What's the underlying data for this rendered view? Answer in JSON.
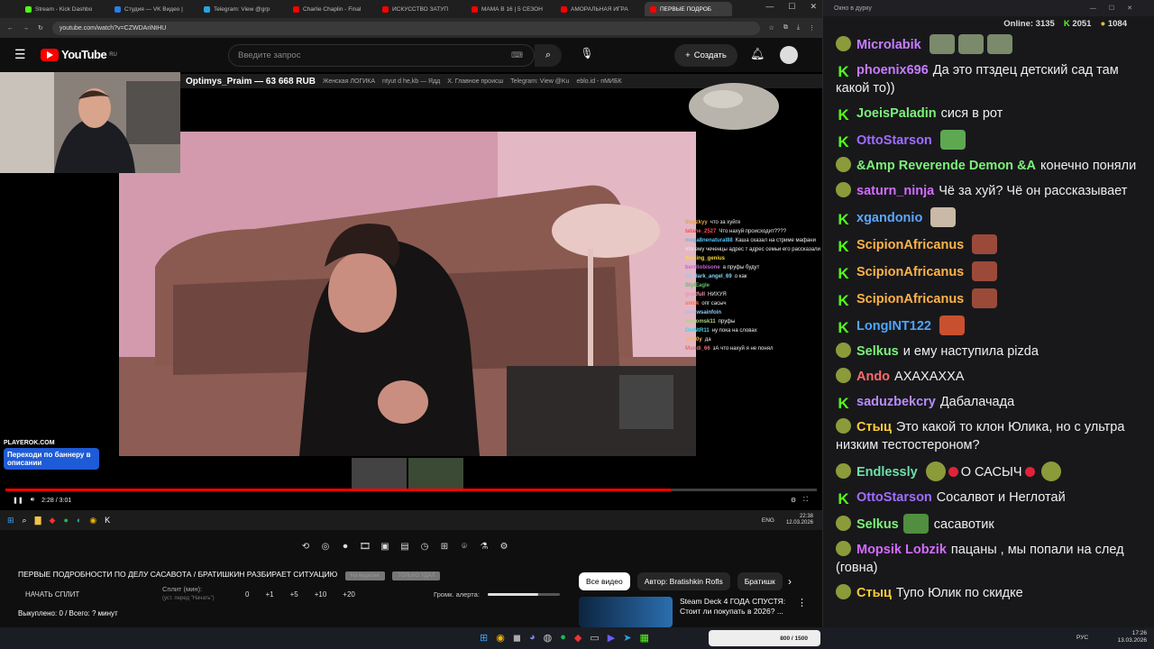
{
  "browser": {
    "tabs": [
      {
        "label": "Stream - Kick Dashbo",
        "color": "#53fc18"
      },
      {
        "label": "Студия — VK Видео |",
        "color": "#2c7be5"
      },
      {
        "label": "Telegram: View @grp",
        "color": "#2aa3e0"
      },
      {
        "label": "Charlie Chaplin - Final",
        "color": "#ff0000"
      },
      {
        "label": "ИСКУССТВО ЗАТУП",
        "color": "#ff0000"
      },
      {
        "label": "МАМА В 16 | 5 СЕЗОН",
        "color": "#ff0000"
      },
      {
        "label": "АМОРАЛЬНАЯ ИГРА",
        "color": "#ff0000"
      },
      {
        "label": "ПЕРВЫЕ ПОДРОБ",
        "color": "#ff0000"
      }
    ],
    "url": "youtube.com/watch?v=CZWDAriNtHU"
  },
  "youtube": {
    "logo": "YouTube",
    "region": "RU",
    "search_placeholder": "Введите запрос",
    "create_label": "Создать"
  },
  "player": {
    "inner_tabs": [
      "Optimys_Praim — 63 668 RUB",
      "Женская ЛОГИКА",
      "ntyut d he,kb — Ядд",
      "Х. Главное происш",
      "Telegram: View @Ku",
      "eblo.id - пМИБК"
    ],
    "overlay_chat": [
      {
        "user": "lilayzkyy",
        "text": "что за хуйгя",
        "color": "#e9a33a"
      },
      {
        "user": "tatane_2527",
        "text": "Что нахуй происходит????",
        "color": "#ff4a4a"
      },
      {
        "user": "mega8nenatural88",
        "text": "Каша сказал на стриме мафани что ему чеченцы адрес т адрес семьи его рассказали",
        "color": "#4fc3f7"
      },
      {
        "user": "fucking_genius",
        "text": "",
        "color": "#fdd835"
      },
      {
        "user": "burritobisone",
        "text": "а пруфы будут",
        "color": "#ba68c8"
      },
      {
        "user": "69_dark_angel_69",
        "text": "о как",
        "color": "#81d4fa"
      },
      {
        "user": "StylEagle",
        "text": "",
        "color": "#66bb6a"
      },
      {
        "user": "graitfull",
        "text": "НИХУЯ",
        "color": "#f48fb1"
      },
      {
        "user": "snick",
        "text": "опг сасыч",
        "color": "#ff7043"
      },
      {
        "user": "meowsainfoin",
        "text": "",
        "color": "#90caf9"
      },
      {
        "user": "wenomsk11",
        "text": "пруфы",
        "color": "#aed581"
      },
      {
        "user": "DmNtR11",
        "text": "ну пока на словах",
        "color": "#4dd0e1"
      },
      {
        "user": "lesh0y",
        "text": "да",
        "color": "#ffb74d"
      },
      {
        "user": "Mundi_66",
        "text": "зА что нахуй я не понял",
        "color": "#e57373"
      }
    ],
    "promo_brand": "PLAYEROK.COM",
    "promo_text": "Переходи по баннеру в описании",
    "time": "2:28 / 3:01",
    "progress": 0.82
  },
  "inner_taskbar": {
    "lang": "ENG",
    "time": "22:38",
    "date": "12.03.2026"
  },
  "extension": {
    "video_title": "ПЕРВЫЕ ПОДРОБНОСТИ ПО ДЕЛУ САСАВОТА / БРАТИШКИН РАЗБИРАЕТ СИТУАЦИЮ",
    "chip1": "На видеоке",
    "chip2": "ТОЛЬКО УДАЛ",
    "split_button": "НАЧАТЬ СПЛИТ",
    "split_label": "Сплит (мин):",
    "split_hint": "(уст. перед \"Начать\")",
    "split_options": [
      "0",
      "+1",
      "+5",
      "+10",
      "+20"
    ],
    "volume_label": "Громк. алерта:",
    "volume_level": 0.7,
    "stats": "Выкуплено: 0 / Всего: ? минут"
  },
  "video_tabs": [
    "Все видео",
    "Автор: Bratishkin Rofls",
    "Братишк"
  ],
  "recommendation": {
    "title": "Steam Deck 4 ГОДА СПУСТЯ: Стоит ли покупать в 2026? ..."
  },
  "os": {
    "lang": "РУС",
    "time": "17:26",
    "date": "13.03.2026",
    "widget": "800 / 1500"
  },
  "chat": {
    "window_title": "Окно в дурку",
    "online_label": "Online:",
    "online_count": "3135",
    "stat1": "2051",
    "stat2": "1084",
    "messages": [
      {
        "badge": "pepe",
        "user": "Microlabik",
        "color": "#c77dff",
        "text": "",
        "emotes": [
          "#7a8a6a",
          "#7a8a6a",
          "#7a8a6a"
        ]
      },
      {
        "badge": "k",
        "user": "phoenix696",
        "color": "#c77dff",
        "text": "Да это птздец детский сад там какой то))"
      },
      {
        "badge": "k",
        "user": "JoeisPaladin",
        "color": "#7cf178",
        "text": "сися в рот"
      },
      {
        "badge": "k",
        "user": "OttoStarson",
        "color": "#a06dff",
        "text": "",
        "emotes": [
          "#5fa852"
        ]
      },
      {
        "badge": "pepe",
        "user": "&Amp Reverende Demon &A",
        "color": "#7cf178",
        "text": "конечно поняли"
      },
      {
        "badge": "pepe",
        "user": "saturn_ninja",
        "color": "#d36bff",
        "text": "Чё за хуй? Чё он рассказывает"
      },
      {
        "badge": "k",
        "user": "xgandonio",
        "color": "#5aa8ff",
        "text": "",
        "emotes": [
          "#c9b9a6"
        ]
      },
      {
        "badge": "k",
        "user": "ScipionAfricanus",
        "color": "#ffb347",
        "text": "",
        "emotes": [
          "#9b4a3a"
        ]
      },
      {
        "badge": "k",
        "user": "ScipionAfricanus",
        "color": "#ffb347",
        "text": "",
        "emotes": [
          "#9b4a3a"
        ]
      },
      {
        "badge": "k",
        "user": "ScipionAfricanus",
        "color": "#ffb347",
        "text": "",
        "emotes": [
          "#9b4a3a"
        ]
      },
      {
        "badge": "k",
        "user": "LongINT122",
        "color": "#4da6ff",
        "text": "",
        "emotes": [
          "#c8502e"
        ]
      },
      {
        "badge": "pepe",
        "user": "Selkus",
        "color": "#7cf178",
        "text": "и ему наступила pizda"
      },
      {
        "badge": "pepe",
        "user": "Ando",
        "color": "#ff6b6b",
        "text": "АХАХАХХА"
      },
      {
        "badge": "k",
        "user": "saduzbekcry",
        "color": "#b98cff",
        "text": "Дабалачада"
      },
      {
        "badge": "pepe",
        "user": "Стыц",
        "color": "#ffcc33",
        "text": "Это какой то клон Юлика, но с ультра низким тестостероном?"
      },
      {
        "badge": "pepe",
        "user": "Endlessly",
        "color": "#6ee0a8",
        "text": "О САСЫЧ",
        "special": true
      },
      {
        "badge": "k",
        "user": "OttoStarson",
        "color": "#a06dff",
        "text": "Сосалвот и Неглотай"
      },
      {
        "badge": "pepe",
        "user": "Selkus",
        "color": "#7cf178",
        "text": "сасавотик",
        "emotes_before": [
          "#4f8f3f"
        ]
      },
      {
        "badge": "pepe",
        "user": "Mopsik Lobzik",
        "color": "#d36bff",
        "text": "пацаны , мы попали на след (говна)"
      },
      {
        "badge": "pepe",
        "user": "Стыц",
        "color": "#ffcc33",
        "text": "Тупо Юлик по скидке"
      }
    ]
  }
}
